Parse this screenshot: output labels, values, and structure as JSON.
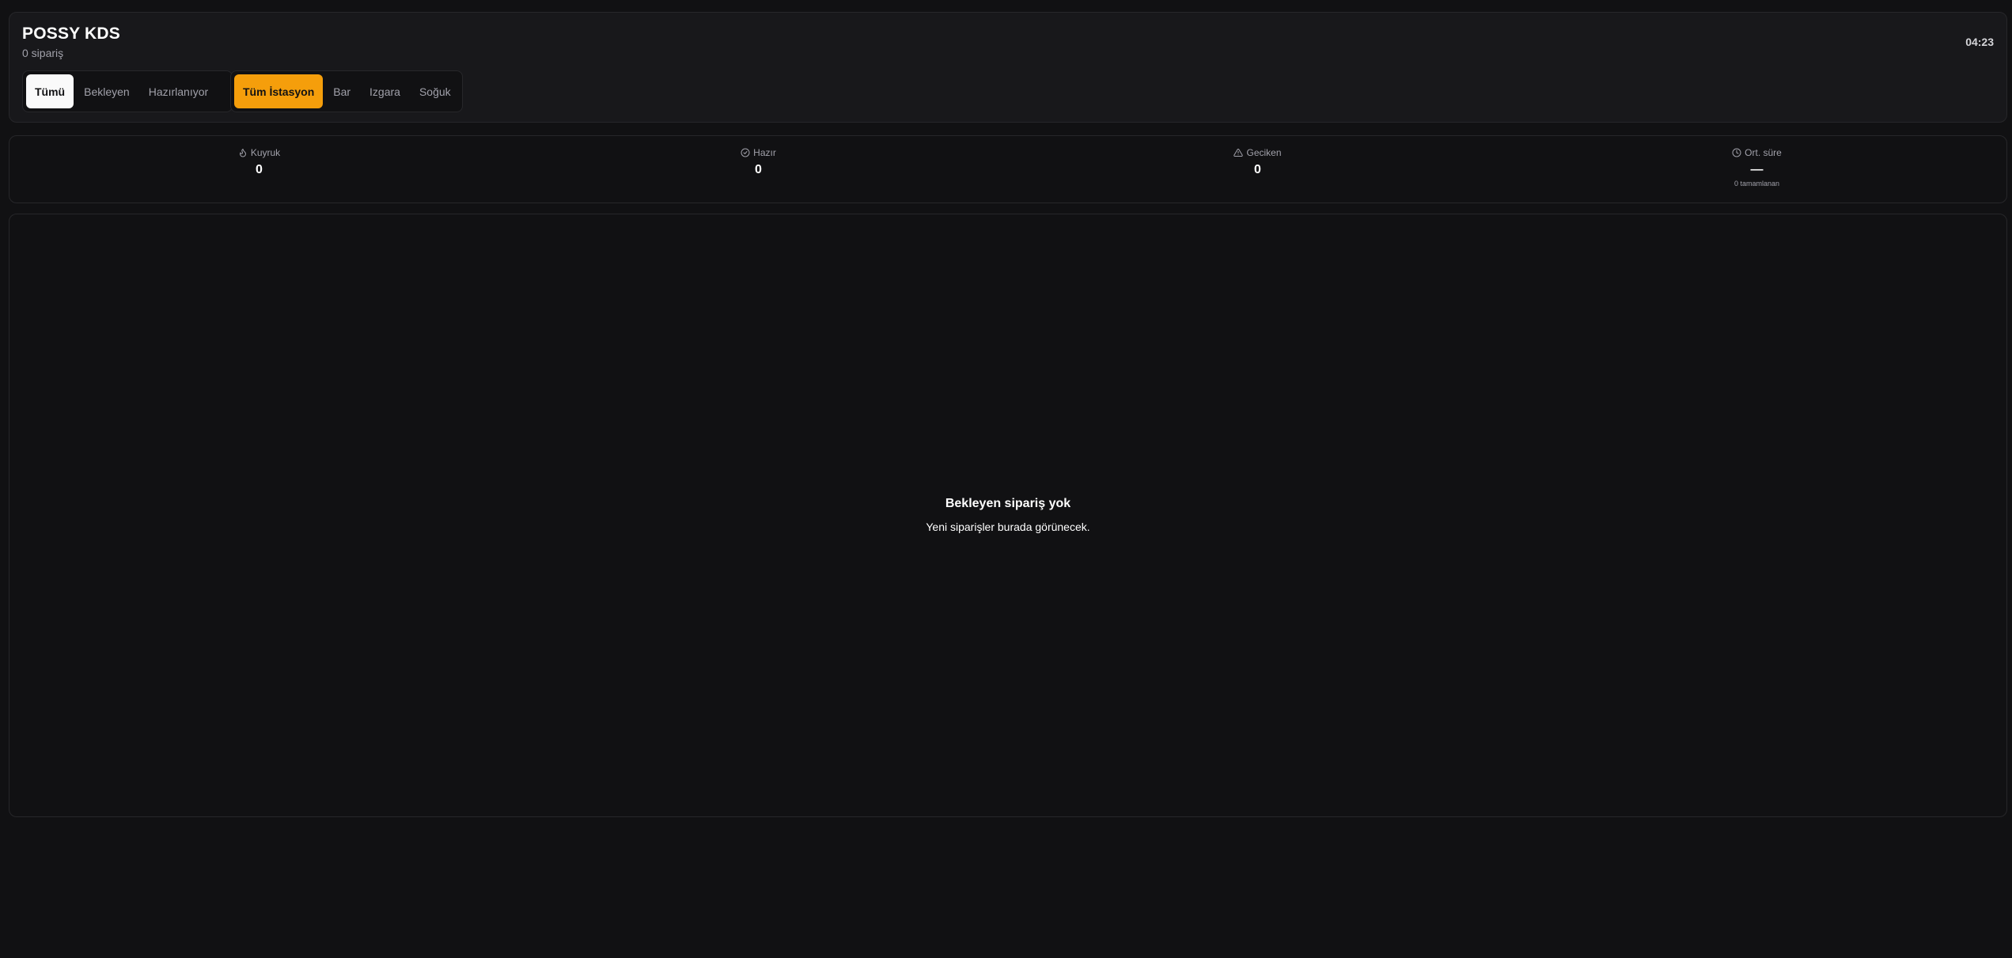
{
  "header": {
    "title": "POSSY KDS",
    "order_count": "0 sipariş",
    "clock": "04:23"
  },
  "status_filters": {
    "selected": "Tümü",
    "items": [
      {
        "label": "Tümü"
      },
      {
        "label": "Bekleyen"
      },
      {
        "label": "Hazırlanıyor"
      }
    ]
  },
  "station_filters": {
    "selected": "Tüm İstasyon",
    "items": [
      {
        "label": "Tüm İstasyon"
      },
      {
        "label": "Bar"
      },
      {
        "label": "Izgara"
      },
      {
        "label": "Soğuk"
      }
    ]
  },
  "stats": [
    {
      "label": "Kuyruk",
      "value": "0",
      "icon": "flame-icon"
    },
    {
      "label": "Hazır",
      "value": "0",
      "icon": "check-circle-icon"
    },
    {
      "label": "Geciken",
      "value": "0",
      "icon": "warning-triangle-icon"
    },
    {
      "label": "Ort. süre",
      "value": "—",
      "sub": "0 tamamlanan",
      "icon": "clock-icon"
    }
  ],
  "empty_state": {
    "title": "Bekleyen sipariş yok",
    "subtitle": "Yeni siparişler burada görünecek."
  },
  "colors": {
    "background": "#111113",
    "card": "#18181b",
    "border": "#27272a",
    "accent": "#f59e0b",
    "muted_text": "#a1a1aa"
  }
}
